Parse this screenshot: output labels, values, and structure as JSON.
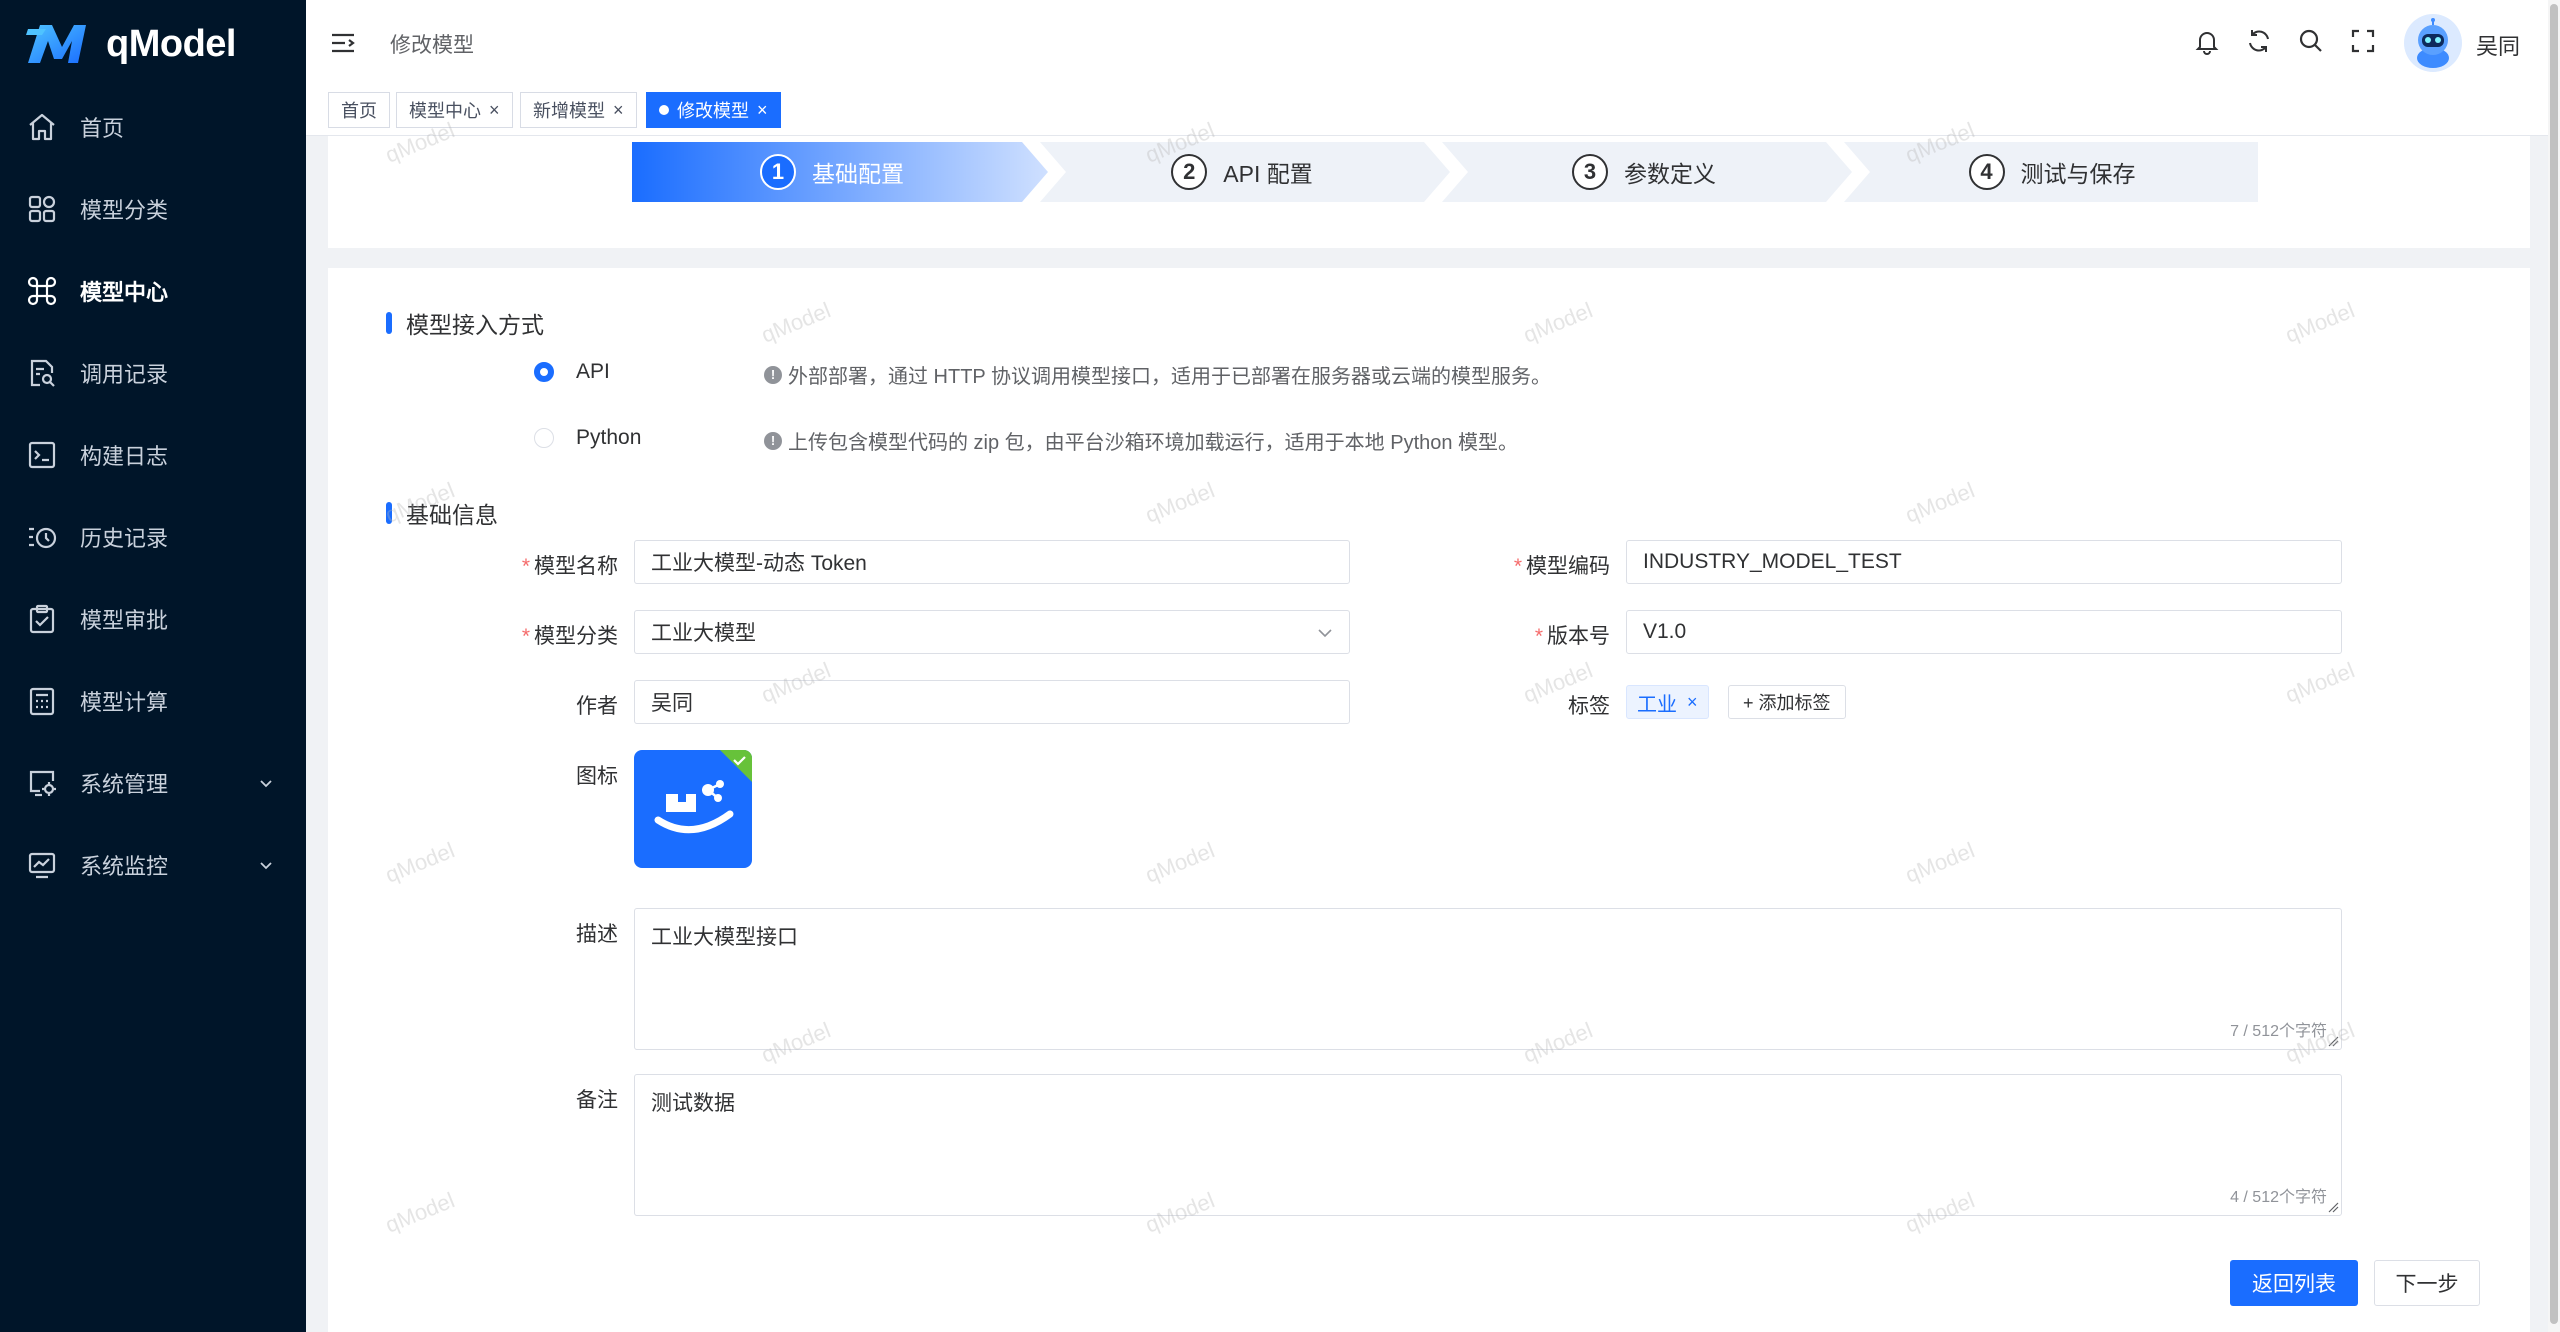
{
  "app": {
    "name": "qModel"
  },
  "sidebar": {
    "items": [
      {
        "label": "首页",
        "icon": "home-icon"
      },
      {
        "label": "模型分类",
        "icon": "grid-icon"
      },
      {
        "label": "模型中心",
        "icon": "command-icon",
        "active": true
      },
      {
        "label": "调用记录",
        "icon": "file-search-icon"
      },
      {
        "label": "构建日志",
        "icon": "terminal-icon"
      },
      {
        "label": "历史记录",
        "icon": "history-icon"
      },
      {
        "label": "模型审批",
        "icon": "clipboard-check-icon"
      },
      {
        "label": "模型计算",
        "icon": "calculator-icon"
      },
      {
        "label": "系统管理",
        "icon": "settings-screen-icon",
        "expandable": true
      },
      {
        "label": "系统监控",
        "icon": "monitor-chart-icon",
        "expandable": true
      }
    ]
  },
  "header": {
    "page_title": "修改模型",
    "user_name": "吴同",
    "icons": [
      "bell-icon",
      "refresh-icon",
      "search-icon",
      "fullscreen-icon"
    ]
  },
  "tabs": [
    {
      "label": "首页",
      "closable": false
    },
    {
      "label": "模型中心",
      "closable": true
    },
    {
      "label": "新增模型",
      "closable": true
    },
    {
      "label": "修改模型",
      "closable": true,
      "active": true
    }
  ],
  "steps": [
    {
      "num": "1",
      "label": "基础配置",
      "active": true
    },
    {
      "num": "2",
      "label": "API 配置"
    },
    {
      "num": "3",
      "label": "参数定义"
    },
    {
      "num": "4",
      "label": "测试与保存"
    }
  ],
  "access": {
    "title": "模型接入方式",
    "options": [
      {
        "label": "API",
        "checked": true,
        "hint": "外部部署，通过 HTTP 协议调用模型接口，适用于已部署在服务器或云端的模型服务。"
      },
      {
        "label": "Python",
        "checked": false,
        "hint": "上传包含模型代码的 zip 包，由平台沙箱环境加载运行，适用于本地 Python 模型。"
      }
    ]
  },
  "basic": {
    "title": "基础信息",
    "model_name_label": "模型名称",
    "model_name": "工业大模型-动态 Token",
    "model_code_label": "模型编码",
    "model_code": "INDUSTRY_MODEL_TEST",
    "category_label": "模型分类",
    "category": "工业大模型",
    "version_label": "版本号",
    "version": "V1.0",
    "author_label": "作者",
    "author": "吴同",
    "tags_label": "标签",
    "tags": [
      "工业"
    ],
    "add_tag": "+ 添加标签",
    "icon_label": "图标",
    "desc_label": "描述",
    "desc": "工业大模型接口",
    "desc_count": "7 / 512个字符",
    "remark_label": "备注",
    "remark": "测试数据",
    "remark_count": "4 / 512个字符"
  },
  "footer": {
    "back": "返回列表",
    "next": "下一步"
  },
  "watermark": "qModel",
  "colors": {
    "primary": "#1a6dff",
    "sidebar": "#001529",
    "required": "#f56c6c",
    "success": "#67c23a"
  }
}
